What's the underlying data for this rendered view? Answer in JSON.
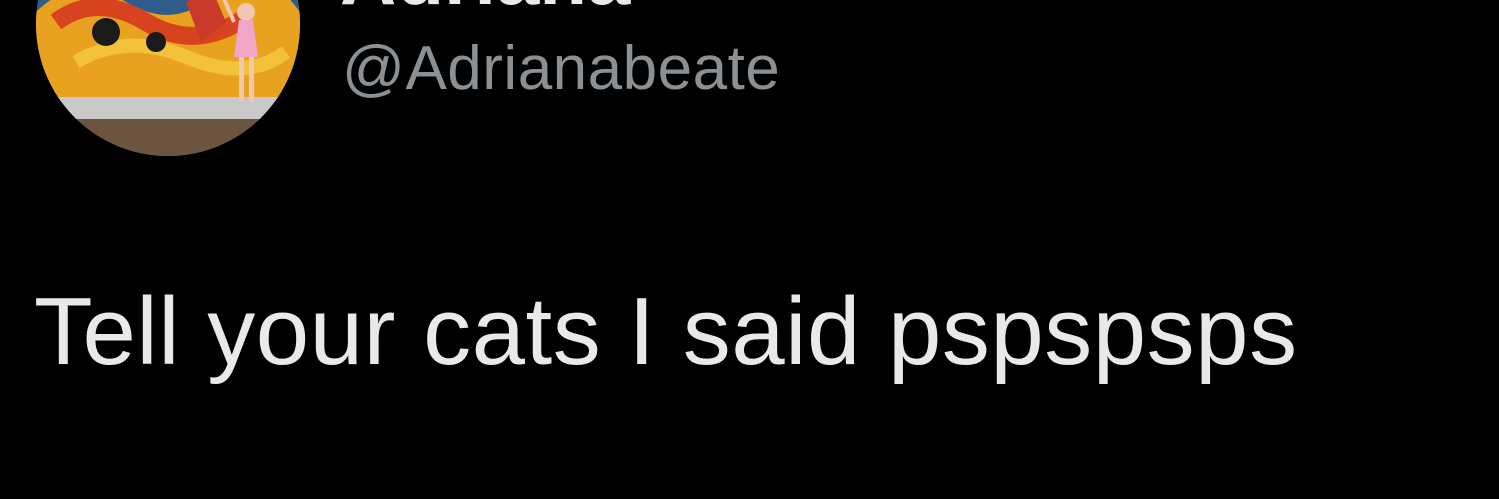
{
  "tweet": {
    "author": {
      "display_name": "Adriana",
      "handle": "@Adrianabeate"
    },
    "text": "Tell your cats I said pspspsps"
  },
  "colors": {
    "background": "#000000",
    "primary_text": "#e7e9ea",
    "secondary_text": "#8b9095"
  }
}
